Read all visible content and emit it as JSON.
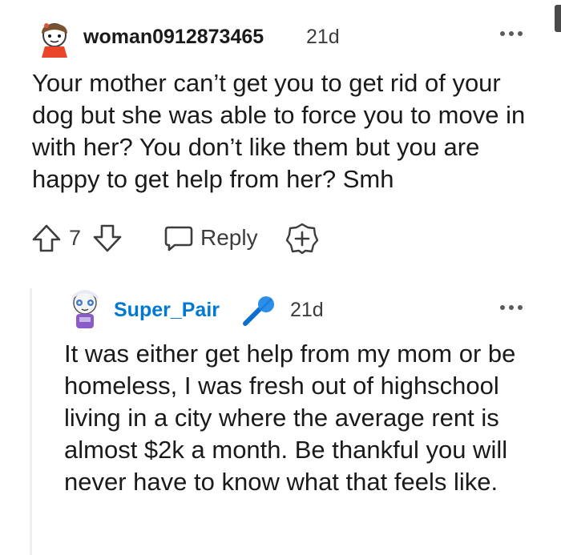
{
  "comment": {
    "username": "woman0912873465",
    "age": "21d",
    "body": "Your mother can’t get you to get rid of your dog but she was able to force you to move in with her? You don’t like them but you are happy to get help from her? Smh",
    "vote_count": "7",
    "reply_label": "Reply",
    "more_icon": "more-dots-icon",
    "reply": {
      "username": "Super_Pair",
      "flair_icon": "microphone-icon",
      "accent_color": "#0079d3",
      "age": "21d",
      "body": "It was either get help from my mom or be homeless, I was fresh out of highschool living in a city where the average rent is almost $2k a month. Be thankful you will never have to know what that feels like."
    }
  }
}
